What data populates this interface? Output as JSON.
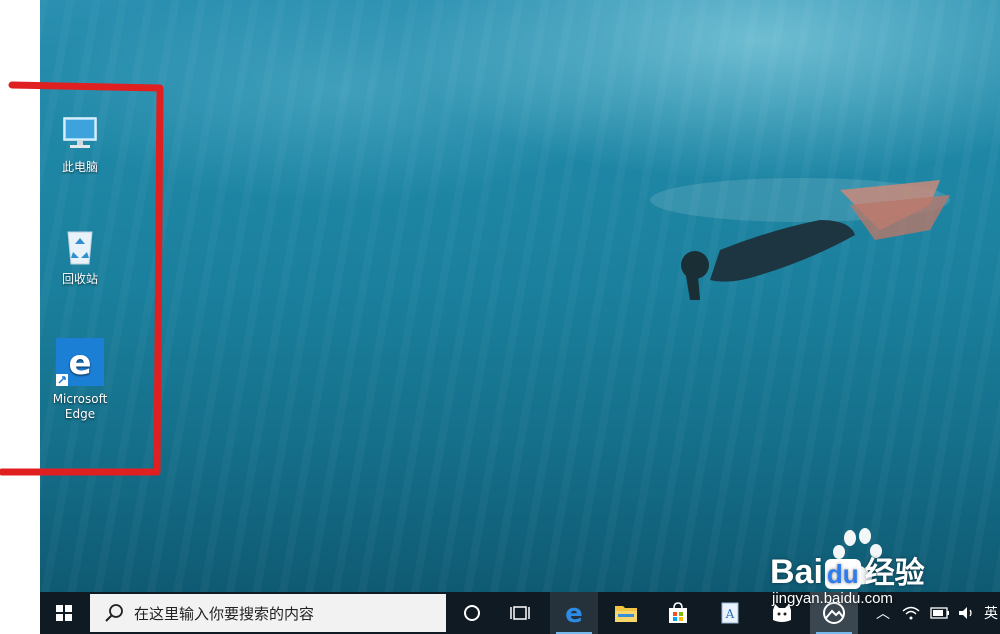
{
  "desktop": {
    "icons": [
      {
        "label": "此电脑",
        "icon": "computer-icon"
      },
      {
        "label": "回收站",
        "icon": "recycle-bin-icon"
      },
      {
        "label_line1": "Microsoft",
        "label_line2": "Edge",
        "icon": "edge-icon"
      }
    ],
    "annotation_color": "#e02020"
  },
  "taskbar": {
    "start_icon": "windows-icon",
    "search_placeholder": "在这里输入你要搜索的内容",
    "apps": [
      "cortana-icon",
      "task-view-icon",
      "edge-icon",
      "file-explorer-icon",
      "store-icon",
      "wordpad-icon",
      "cat-app-icon",
      "photos-icon"
    ],
    "tray": {
      "language": "英"
    }
  },
  "watermark": {
    "brand": "Bai",
    "brand2": "du",
    "brand_suffix": "经验",
    "site": "jingyan.baidu.com"
  }
}
